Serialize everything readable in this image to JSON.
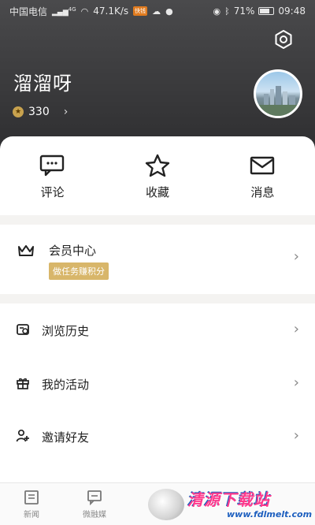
{
  "status_bar": {
    "carrier": "中国电信",
    "network_sup": "4G",
    "speed": "47.1K/s",
    "app_badge": "快钱",
    "battery_percent": "71%",
    "battery_level": 0.71,
    "time": "09:48"
  },
  "profile": {
    "username": "溜溜呀",
    "points": "330"
  },
  "quick_actions": [
    {
      "label": "评论",
      "icon": "comment-icon"
    },
    {
      "label": "收藏",
      "icon": "star-icon"
    },
    {
      "label": "消息",
      "icon": "mail-icon"
    }
  ],
  "member": {
    "title": "会员中心",
    "tag": "做任务赚积分",
    "icon": "crown-icon"
  },
  "menu": [
    {
      "label": "浏览历史",
      "icon": "history-icon"
    },
    {
      "label": "我的活动",
      "icon": "gift-icon"
    },
    {
      "label": "邀请好友",
      "icon": "add-user-icon"
    }
  ],
  "bottom_nav": [
    {
      "label": "新闻",
      "icon": "news-icon"
    },
    {
      "label": "微融媒",
      "icon": "chat-icon"
    }
  ],
  "watermark": {
    "title": "清源下载站",
    "url": "www.fdlmelt.com"
  },
  "colors": {
    "header_bg": "#3a3a3c",
    "tag_gold": "#d8b66a",
    "divider": "#f4f3f1"
  }
}
